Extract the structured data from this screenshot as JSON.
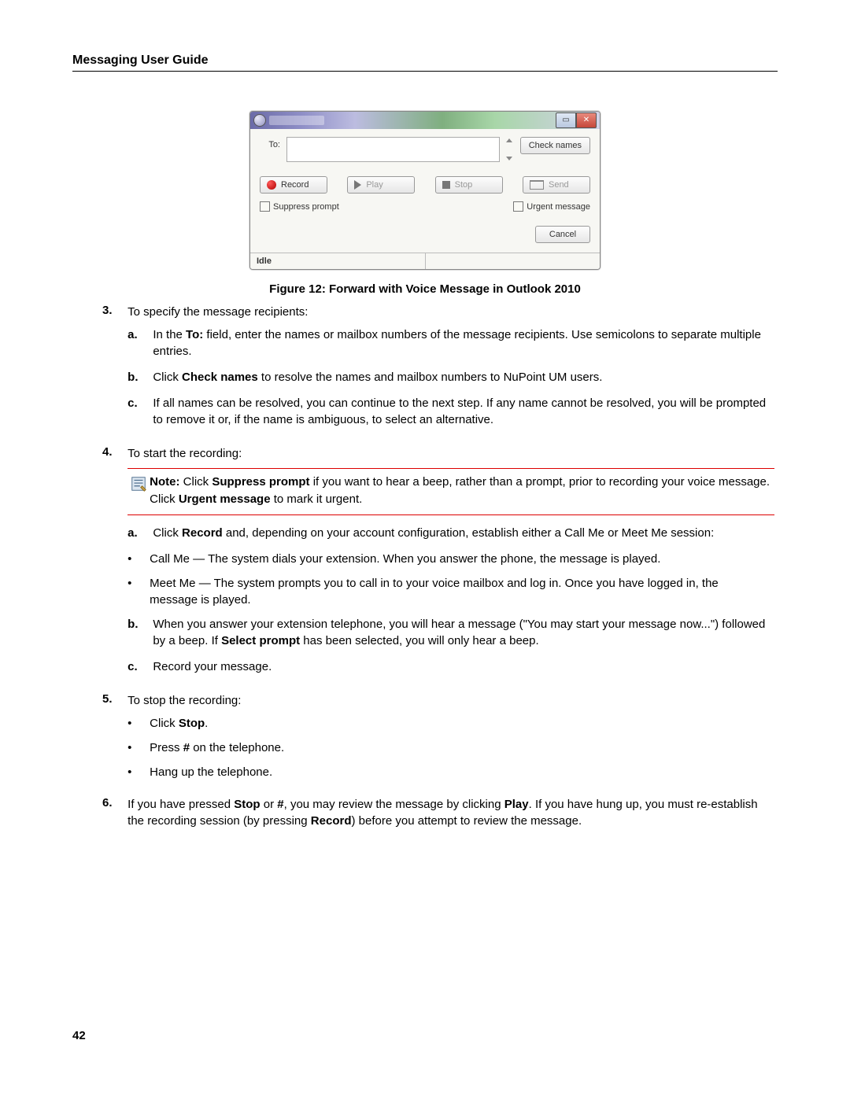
{
  "header": "Messaging User Guide",
  "page_number": "42",
  "figure_caption": "Figure 12: Forward with Voice Message in Outlook 2010",
  "dialog": {
    "to_label": "To:",
    "check_names": "Check names",
    "record": "Record",
    "play": "Play",
    "stop": "Stop",
    "send": "Send",
    "suppress": "Suppress prompt",
    "urgent": "Urgent message",
    "cancel": "Cancel",
    "status": "Idle"
  },
  "step3": {
    "num": "3.",
    "text": "To specify the message recipients:",
    "a_let": "a.",
    "a_pre": "In the ",
    "a_bold": "To:",
    "a_post": " field, enter the names or mailbox numbers of the message recipients. Use semicolons to separate multiple entries.",
    "b_let": "b.",
    "b_pre": "Click ",
    "b_bold": "Check names",
    "b_post": " to resolve the names and mailbox numbers to NuPoint UM users.",
    "c_let": "c.",
    "c_text": "If all names can be resolved, you can continue to the next step. If any name cannot be resolved, you will be prompted to remove it or, if the name is ambiguous, to select an alternative."
  },
  "step4": {
    "num": "4.",
    "text": "To start the recording:",
    "note_bold1": "Note:",
    "note_t1": " Click ",
    "note_bold2": "Suppress prompt",
    "note_t2": " if you want to hear a beep, rather than a prompt, prior to recording your voice message. Click ",
    "note_bold3": "Urgent message",
    "note_t3": " to mark it urgent.",
    "a_let": "a.",
    "a_pre": "Click ",
    "a_bold": "Record",
    "a_post": " and, depending on your account configuration, establish either a Call Me or Meet Me session:",
    "bul1": "Call Me — The system dials your extension. When you answer the phone, the message is played.",
    "bul2": "Meet Me — The system prompts you to call in to your voice mailbox and log in. Once you have logged in, the message is played.",
    "b_let": "b.",
    "b_pre": "When you answer your extension telephone, you will hear a message (\"You may start your message now...\") followed by a beep. If ",
    "b_bold": "Select prompt",
    "b_post": " has been selected, you will only hear a beep.",
    "c_let": "c.",
    "c_text": "Record your message."
  },
  "step5": {
    "num": "5.",
    "text": "To stop the recording:",
    "bul1a": "Click ",
    "bul1b": "Stop",
    "bul1c": ".",
    "bul2a": "Press ",
    "bul2b": "#",
    "bul2c": " on the telephone.",
    "bul3": "Hang up the telephone."
  },
  "step6": {
    "num": "6.",
    "t1": "If you have pressed ",
    "b1": "Stop",
    "t2": " or ",
    "b2": "#",
    "t3": ", you may review the message by clicking ",
    "b3": "Play",
    "t4": ". If you have hung up, you must re-establish the recording session (by pressing ",
    "b4": "Record",
    "t5": ") before you attempt to review the message."
  }
}
